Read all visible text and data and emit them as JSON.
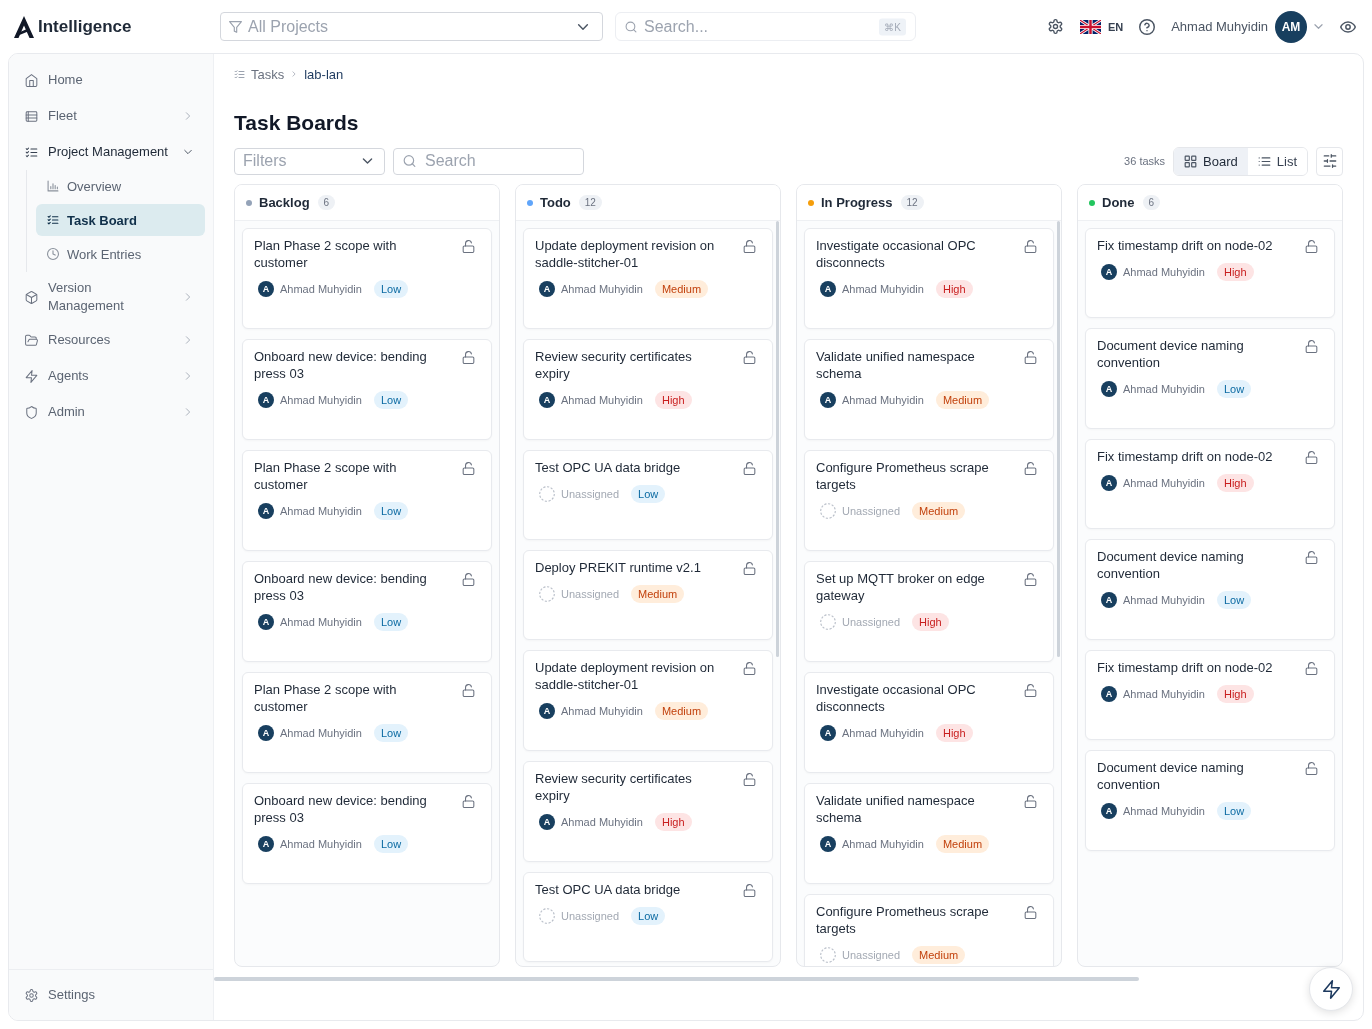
{
  "top_bar": {
    "brand": "Intelligence",
    "project_select": {
      "placeholder": "All Projects"
    },
    "search": {
      "placeholder": "Search...",
      "shortcut": "⌘K"
    },
    "language": "EN",
    "user": {
      "name": "Ahmad Muhyidin",
      "initials": "AM"
    }
  },
  "sidebar": {
    "items": [
      {
        "label": "Home",
        "kind": "link",
        "selected": false
      },
      {
        "label": "Fleet",
        "kind": "group",
        "selected": false,
        "expanded": false
      },
      {
        "label": "Project Management",
        "kind": "group",
        "selected": true,
        "expanded": true,
        "children": [
          {
            "label": "Overview",
            "selected": false
          },
          {
            "label": "Task Board",
            "selected": true
          },
          {
            "label": "Work Entries",
            "selected": false
          }
        ]
      },
      {
        "label": "Version Management",
        "kind": "group",
        "selected": false,
        "expanded": false
      },
      {
        "label": "Resources",
        "kind": "group",
        "selected": false,
        "expanded": false
      },
      {
        "label": "Agents",
        "kind": "group",
        "selected": false,
        "expanded": false
      },
      {
        "label": "Admin",
        "kind": "group",
        "selected": false,
        "expanded": false
      }
    ],
    "footer_item": {
      "label": "Settings"
    }
  },
  "breadcrumb": [
    {
      "label": "Tasks"
    },
    {
      "label": "lab-lan"
    }
  ],
  "page_title": "Task Boards",
  "toolbar": {
    "filters": {
      "placeholder": "Filters"
    },
    "search": {
      "placeholder": "Search"
    },
    "task_count": "36 tasks",
    "view_tabs": [
      {
        "label": "Board",
        "selected": true
      },
      {
        "label": "List",
        "selected": false
      }
    ]
  },
  "columns": [
    {
      "title": "Backlog",
      "count": "6",
      "color": "#94a3b8",
      "cards": [
        {
          "title": "Plan Phase 2 scope with customer",
          "assigned": true,
          "initial": "A",
          "assignee": "Ahmad Muhyidin",
          "priority": {
            "label": "Low",
            "kind": "low"
          }
        },
        {
          "title": "Onboard new device: bending press 03",
          "assigned": true,
          "initial": "A",
          "assignee": "Ahmad Muhyidin",
          "priority": {
            "label": "Low",
            "kind": "low"
          }
        },
        {
          "title": "Plan Phase 2 scope with customer",
          "assigned": true,
          "initial": "A",
          "assignee": "Ahmad Muhyidin",
          "priority": {
            "label": "Low",
            "kind": "low"
          }
        },
        {
          "title": "Onboard new device: bending press 03",
          "assigned": true,
          "initial": "A",
          "assignee": "Ahmad Muhyidin",
          "priority": {
            "label": "Low",
            "kind": "low"
          }
        },
        {
          "title": "Plan Phase 2 scope with customer",
          "assigned": true,
          "initial": "A",
          "assignee": "Ahmad Muhyidin",
          "priority": {
            "label": "Low",
            "kind": "low"
          }
        },
        {
          "title": "Onboard new device: bending press 03",
          "assigned": true,
          "initial": "A",
          "assignee": "Ahmad Muhyidin",
          "priority": {
            "label": "Low",
            "kind": "low"
          }
        }
      ]
    },
    {
      "title": "Todo",
      "count": "12",
      "color": "#60a5fa",
      "cards": [
        {
          "title": "Update deployment revision on saddle-stitcher-01",
          "assigned": true,
          "initial": "A",
          "assignee": "Ahmad Muhyidin",
          "priority": {
            "label": "Medium",
            "kind": "medium"
          }
        },
        {
          "title": "Review security certificates expiry",
          "assigned": true,
          "initial": "A",
          "assignee": "Ahmad Muhyidin",
          "priority": {
            "label": "High",
            "kind": "high"
          }
        },
        {
          "title": "Test OPC UA data bridge",
          "assigned": false,
          "assignee": "Unassigned",
          "priority": {
            "label": "Low",
            "kind": "low"
          }
        },
        {
          "title": "Deploy PREKIT runtime v2.1",
          "assigned": false,
          "assignee": "Unassigned",
          "priority": {
            "label": "Medium",
            "kind": "medium"
          }
        },
        {
          "title": "Update deployment revision on saddle-stitcher-01",
          "assigned": true,
          "initial": "A",
          "assignee": "Ahmad Muhyidin",
          "priority": {
            "label": "Medium",
            "kind": "medium"
          }
        },
        {
          "title": "Review security certificates expiry",
          "assigned": true,
          "initial": "A",
          "assignee": "Ahmad Muhyidin",
          "priority": {
            "label": "High",
            "kind": "high"
          }
        },
        {
          "title": "Test OPC UA data bridge",
          "assigned": false,
          "assignee": "Unassigned",
          "priority": {
            "label": "Low",
            "kind": "low"
          }
        }
      ]
    },
    {
      "title": "In Progress",
      "count": "12",
      "color": "#f59e0b",
      "cards": [
        {
          "title": "Investigate occasional OPC disconnects",
          "assigned": true,
          "initial": "A",
          "assignee": "Ahmad Muhyidin",
          "priority": {
            "label": "High",
            "kind": "high"
          }
        },
        {
          "title": "Validate unified namespace schema",
          "assigned": true,
          "initial": "A",
          "assignee": "Ahmad Muhyidin",
          "priority": {
            "label": "Medium",
            "kind": "medium"
          }
        },
        {
          "title": "Configure Prometheus scrape targets",
          "assigned": false,
          "assignee": "Unassigned",
          "priority": {
            "label": "Medium",
            "kind": "medium"
          }
        },
        {
          "title": "Set up MQTT broker on edge gateway",
          "assigned": false,
          "assignee": "Unassigned",
          "priority": {
            "label": "High",
            "kind": "high"
          }
        },
        {
          "title": "Investigate occasional OPC disconnects",
          "assigned": true,
          "initial": "A",
          "assignee": "Ahmad Muhyidin",
          "priority": {
            "label": "High",
            "kind": "high"
          }
        },
        {
          "title": "Validate unified namespace schema",
          "assigned": true,
          "initial": "A",
          "assignee": "Ahmad Muhyidin",
          "priority": {
            "label": "Medium",
            "kind": "medium"
          }
        },
        {
          "title": "Configure Prometheus scrape targets",
          "assigned": false,
          "assignee": "Unassigned",
          "priority": {
            "label": "Medium",
            "kind": "medium"
          }
        }
      ]
    },
    {
      "title": "Done",
      "count": "6",
      "color": "#22c55e",
      "cards": [
        {
          "title": "Fix timestamp drift on node-02",
          "assigned": true,
          "initial": "A",
          "assignee": "Ahmad Muhyidin",
          "priority": {
            "label": "High",
            "kind": "high"
          }
        },
        {
          "title": "Document device naming convention",
          "assigned": true,
          "initial": "A",
          "assignee": "Ahmad Muhyidin",
          "priority": {
            "label": "Low",
            "kind": "low"
          }
        },
        {
          "title": "Fix timestamp drift on node-02",
          "assigned": true,
          "initial": "A",
          "assignee": "Ahmad Muhyidin",
          "priority": {
            "label": "High",
            "kind": "high"
          }
        },
        {
          "title": "Document device naming convention",
          "assigned": true,
          "initial": "A",
          "assignee": "Ahmad Muhyidin",
          "priority": {
            "label": "Low",
            "kind": "low"
          }
        },
        {
          "title": "Fix timestamp drift on node-02",
          "assigned": true,
          "initial": "A",
          "assignee": "Ahmad Muhyidin",
          "priority": {
            "label": "High",
            "kind": "high"
          }
        },
        {
          "title": "Document device naming convention",
          "assigned": true,
          "initial": "A",
          "assignee": "Ahmad Muhyidin",
          "priority": {
            "label": "Low",
            "kind": "low"
          }
        }
      ]
    }
  ]
}
